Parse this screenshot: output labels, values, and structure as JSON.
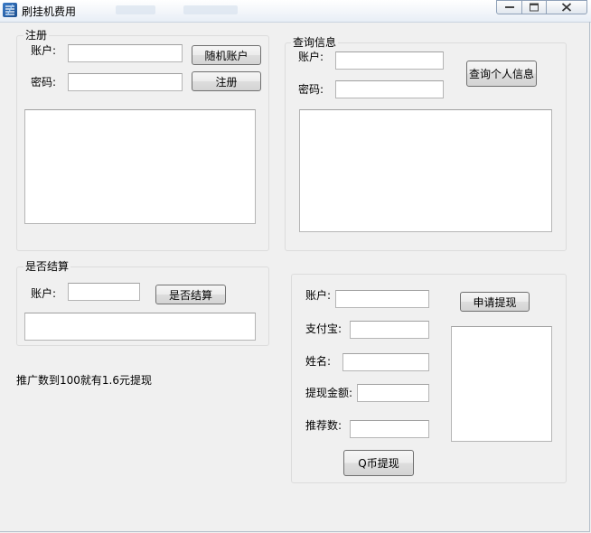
{
  "window": {
    "title": "刷挂机费用"
  },
  "register": {
    "group_title": "注册",
    "account_label": "账户:",
    "password_label": "密码:",
    "account_value": "",
    "password_value": "",
    "random_account_button": "随机账户",
    "register_button": "注册",
    "output_text": ""
  },
  "query": {
    "group_title": "查询信息",
    "account_label": "账户:",
    "password_label": "密码:",
    "account_value": "",
    "password_value": "",
    "query_button": "查询个人信息",
    "output_text": ""
  },
  "settle": {
    "group_title": "是否结算",
    "account_label": "账户:",
    "account_value": "",
    "settle_button": "是否结算",
    "output_text": ""
  },
  "promo_text": "推广数到100就有1.6元提现",
  "withdraw": {
    "account_label": "账户:",
    "alipay_label": "支付宝:",
    "name_label": "姓名:",
    "amount_label": "提现金额:",
    "referrals_label": "推荐数:",
    "account_value": "",
    "alipay_value": "",
    "name_value": "",
    "amount_value": "",
    "referrals_value": "",
    "apply_button": "申请提现",
    "qcoin_button": "Q币提现",
    "output_text": ""
  }
}
